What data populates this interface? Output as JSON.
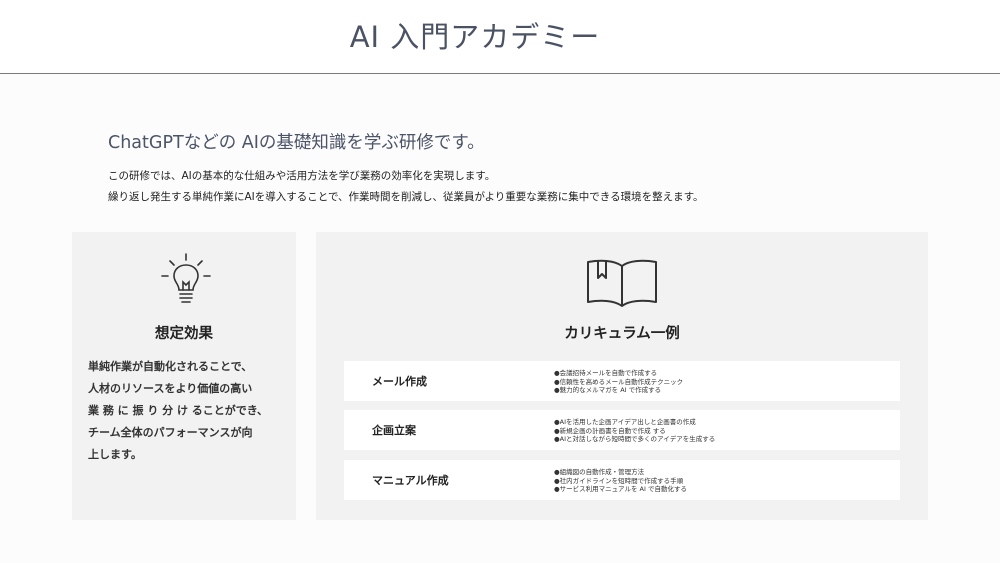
{
  "header": {
    "title": "AI 入門アカデミー"
  },
  "intro": {
    "subtitle": "ChatGPTなどの AIの基礎知識を学ぶ研修です。",
    "description": [
      "この研修では、AIの基本的な仕組みや活用方法を学び業務の効率化を実現します。",
      "繰り返し発生する単純作業にAIを導入することで、作業時間を削減し、従業員がより重要な業務に集中できる環境を整えます。"
    ]
  },
  "effects": {
    "icon": "lightbulb-icon",
    "heading": "想定効果",
    "lines": [
      "単純作業が自動化されることで、",
      "人材のリソースをより価値の高い",
      "業 務 に 振 り 分 け ることができ、",
      "チーム全体のパフォーマンスが向",
      "上します。"
    ]
  },
  "curriculum": {
    "icon": "open-book-icon",
    "heading": "カリキュラム一例",
    "rows": [
      {
        "label": "メール作成",
        "items": [
          "●会議招待メールを自動で作成する",
          "●信頼性を高めるメール自動作成テクニック",
          "●魅力的なメルマガを AI で作成する"
        ]
      },
      {
        "label": "企画立案",
        "items": [
          "●AIを活用した企画アイデア出しと企画書の作成",
          "●新規企画の計画書を自動で作成 する",
          "●AIと対話しながら短時間で多くのアイデアを生成する"
        ]
      },
      {
        "label": "マニュアル作成",
        "items": [
          "●組織図の自動作成・管理方法",
          "●社内ガイドラインを短時間で作成する手順",
          "●サービス利用マニュアルを AI で自動化する"
        ]
      }
    ]
  },
  "colors": {
    "title": "#4a5264",
    "panel_background": "#f2f2f2",
    "row_background": "#ffffff"
  }
}
